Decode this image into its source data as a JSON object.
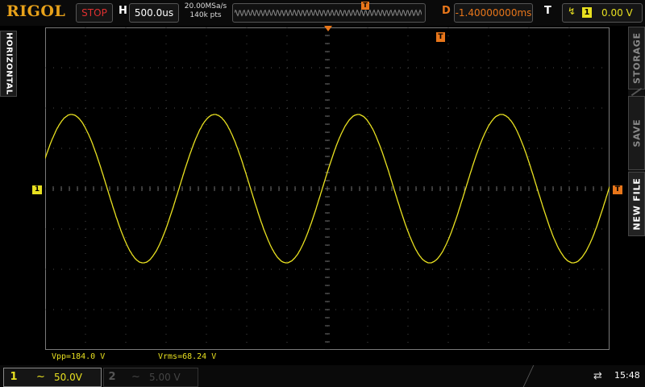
{
  "brand": "RIGOL",
  "run_status": "STOP",
  "horizontal": {
    "label": "H",
    "timebase": "500.0us",
    "sample_rate": "20.00MSa/s",
    "memory_depth": "140k pts",
    "delay_label": "D",
    "delay": "-1.40000000ms",
    "trigger_pos_marker": "T"
  },
  "trigger": {
    "label": "T",
    "edge": "rising-edge-icon",
    "source": "1",
    "level": "0.00 V",
    "marker": "T"
  },
  "side_tab_left": "HORIZONTAL",
  "right_menu": {
    "items": [
      "STORAGE",
      "SAVE",
      "NEW FILE"
    ]
  },
  "channel_markers": {
    "ch1": "1"
  },
  "measurements": {
    "vpp": "Vpp=184.0 V",
    "vrms": "Vrms=68.24 V"
  },
  "channels": [
    {
      "num": "1",
      "coupling": "~",
      "scale": "50.0V",
      "color": "#e8e020",
      "active": true
    },
    {
      "num": "2",
      "coupling": "~",
      "scale": "5.00 V",
      "color": "#444444",
      "active": false
    }
  ],
  "status_bar": {
    "usb_icon": "usb-icon",
    "usb_glyph": "⇄",
    "time": "15:48"
  },
  "waveform": {
    "type": "sine",
    "color": "#e8e020",
    "vpp_volts": 184.0,
    "volts_per_div": 50.0,
    "time_per_div_us": 500.0,
    "period_us": 1777.8,
    "phase_deg_at_left": 24,
    "cycles_shown": 2.8
  },
  "colors": {
    "trigger_accent": "#e8761a",
    "ch1": "#e8e020",
    "stop": "#e03030"
  }
}
